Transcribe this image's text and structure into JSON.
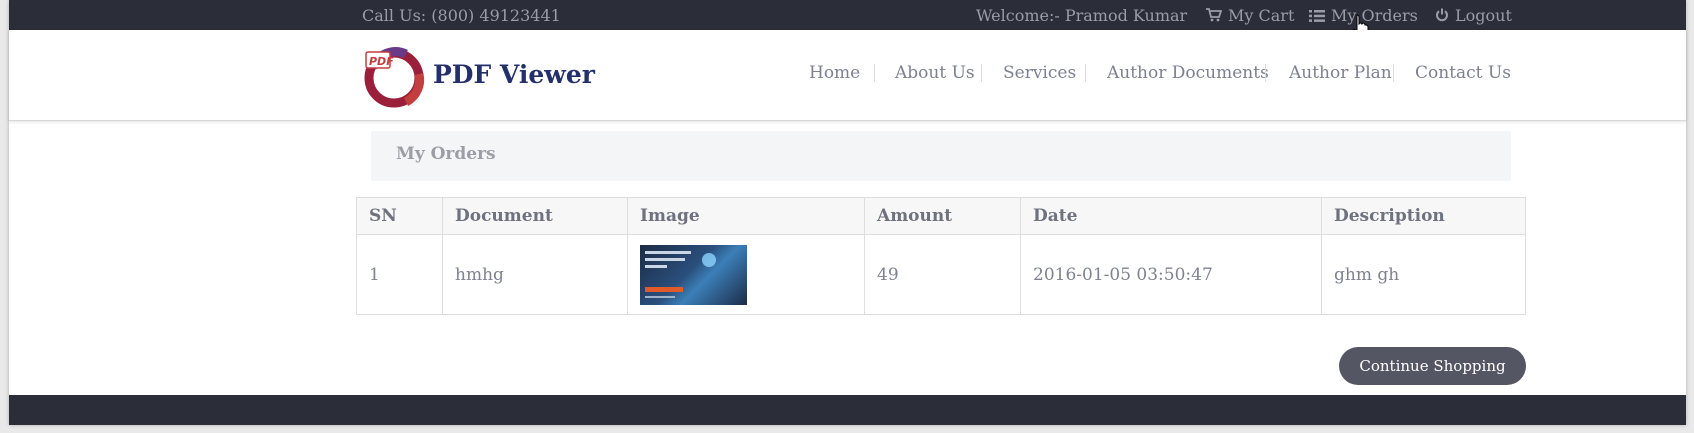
{
  "topbar": {
    "call": "Call Us: (800) 49123441",
    "welcome": "Welcome:- Pramod Kumar",
    "cart": "My Cart",
    "orders": "My Orders",
    "logout": "Logout"
  },
  "brand": {
    "name": "PDF Viewer",
    "logo_text": "PDF"
  },
  "nav": [
    "Home",
    "About Us",
    "Services",
    "Author Documents",
    "Author Plan",
    "Contact Us"
  ],
  "page": {
    "title": "My Orders"
  },
  "table": {
    "headers": [
      "SN",
      "Document",
      "Image",
      "Amount",
      "Date",
      "Description"
    ],
    "rows": [
      {
        "sn": "1",
        "document": "hmhg",
        "amount": "49",
        "date": "2016-01-05 03:50:47",
        "description": "ghm gh"
      }
    ]
  },
  "button": {
    "continue": "Continue Shopping"
  },
  "colors": {
    "topbar": "#2b2e38",
    "brand": "#24306b",
    "button": "#555663"
  }
}
